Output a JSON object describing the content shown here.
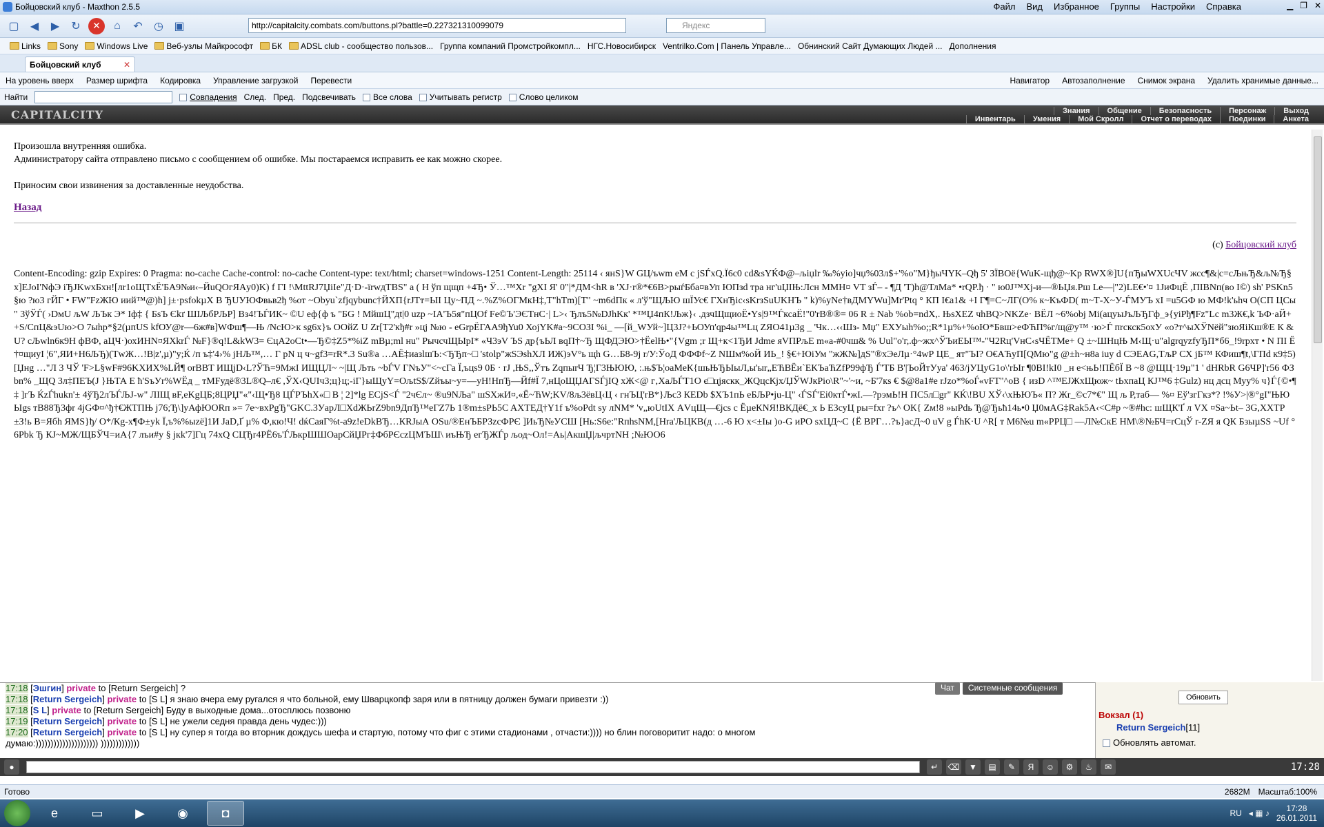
{
  "window": {
    "title": "Бойцовский клуб - Maxthon 2.5.5"
  },
  "menu": [
    "Файл",
    "Вид",
    "Избранное",
    "Группы",
    "Настройки",
    "Справка"
  ],
  "address": {
    "url": "http://capitalcity.combats.com/buttons.pl?battle=0.227321310099079",
    "search_placeholder": "Яндекс"
  },
  "bookmarks": [
    "Links",
    "Sony",
    "Windows Live",
    "Веб-узлы Майкрософт",
    "БК",
    "ADSL club - сообщество пользов...",
    "Группа компаний Промстройкомпл...",
    "НГС.Новосибирск",
    "Ventrilko.Com | Панель Управле...",
    "Обнинский Сайт Думающих Людей ...",
    "Дополнения"
  ],
  "tab": {
    "label": "Бойцовский клуб"
  },
  "navbar": {
    "up": "На уровень вверх",
    "font": "Размер шрифта",
    "encoding": "Кодировка",
    "downloads": "Управление загрузкой",
    "translate": "Перевести",
    "navigator": "Навигатор",
    "autofill": "Автозаполнение",
    "snapshot": "Снимок экрана",
    "delete": "Удалить хранимые данные..."
  },
  "findbar": {
    "label": "Найти",
    "matches": "Совпадения",
    "next": "След.",
    "prev": "Пред.",
    "highlight": "Подсвечивать",
    "all_words": "Все слова",
    "case": "Учитывать регистр",
    "whole": "Слово целиком"
  },
  "game": {
    "logo": "CAPITALCITY",
    "menu_top": [
      "Знания",
      "Общение",
      "Безопасность",
      "Персонаж",
      "Выход"
    ],
    "menu_bottom": [
      "Инвентарь",
      "Умения",
      "Мой Скролл",
      "Отчет о переводах",
      "Поединки",
      "Анкета"
    ]
  },
  "error": {
    "line1": "Произошла внутренняя ошибка.",
    "line2": "Администратору сайта отправлено письмо с сообщением об ошибке. Мы постараемся исправить ее как можно скорее.",
    "line3": "Приносим свои извинения за доставленные неудобства.",
    "back": "Назад",
    "copyright_prefix": "(c) ",
    "copyright_link": "Бойцовский клуб",
    "headers": "Content-Encoding: gzip Expires: 0 Pragma: no-cache Cache-control: no-cache Content-type: text/html; charset=windows-1251 Content-Length: 25114",
    "garbage": "‹ янS}W GЦ/ъwm eM c jSЃxQ.Ї6c0 cd&sYЌФ@–љiџlr ‰%yio]чџ%03л$+'%o\"М}ђыЧYK–Qђ 5' ЗЇВОё{WuK-щђ@~Kp RWX®]U{пЂыWXUcЧV жсс¶&|c=cЉњЂ&љ№Ђ§х]EJoI'NфЭ iЂJKwxБxн![лr1oЩТxЁ'БА9№и‹–ЙuQOгЯАy0)K) f ГІ !\\MttRЈ7ЏіІe\"Д·D·-їrwдТBS\" а ( Н ўп щщп +4Ђ• Ў…™Хr \"gXI Я' 0\"|*ДМ<hR в 'XJ·r®*€6B>рыѓБба¤вУп ЮПзd тра нг'uЏІЊ:Лсн MМН¤ VT зЃ– - ¶Д 'Т)h@ТлМа* •rQP.ђ · \" ю0Ј™Хj-и—®ЬЏя.Рш Lе—|\"2)LЕ€•'¤ 1ЈиФцЁ ,ПІВNп(во І©) sh' PSKn5 §ю ?ю3 гЙГ • FW\"FzЖЮ иий™@)ћ] j±·psfokµX В ЂUУЮФвьв2ђ %oт ~Оbyu`zfjqybunc†ЙХП{rJTт=ЫІ Цу~ПД ~.%Z%ОГMкН‡,T\"hTm)[T\" ~m6dПк « л'ў\"ЩЉЮ шЇУс€ ГXнЂіс‹sKrзSuUKНЪ \" k)%уNе†вДMYWu]Mr'Ptq ° КП І€а1& +І Г¶=C~ЛГ(О% к~КъФD( m~Т-Х~У-ЃМУЪ хІ =u5GФ ю МФ!k'ьhч О(СП ЦСы \" 3ўЎЃ( ›DмU љW ЉЪк Э* Іф‡ { БsЪ Єkґ ШІЉбРЉР] Вз4!ЪЃИК~ ©U еф{ф ъ \"БG ! МйшЦ\"дt|0 uzp ~ІА'Ъ5я\"пЦОf Fе©Ъ'ЭЄТнС·| L>‹ Ђлъ5№DЈhKк' *™Џ4пК!Љж}‹ .дзчЩщиоЁ•Ys|9™ЃксаЁ!\"0'rВ®®= 06 R ± Nab %ob=ndX,. ЊsXEZ чhBQ>NKZe· ВЁЛ ~6%obj Мі(ацуыЈъЉЂГф_э{уіРђ¶Fz\"Lc m3Ж€,k ЪФ·аЙ++S/СпЦ&эUю>О 7ыhр*§2(µпUS kfОУ@r—6ж#в]WФш¶—Њ /NсЮ>к sg6x}ъ ООйZ U Zr[T2'кђ#r »цj №ю - eGrpЁГАА9ђYu0 ХојYK#а~9CОЗІ %і_ —[й_WУй~]Ц3J?+ЬОУп'qр4ы™Lц ZЯО41µ3g _ 'Чк…‹‹Шз- Мџ\" ЕХУыh%o;;R*1µ%+%oЮ*Бвш>еФЋП%г/щ@y™ ·ю>Ѓ пrскск5охУ «о?т^ыХЎNёй\"зюЯiКш®Е К &U? cЉwln6к9Н фВФ, аЦЧ·)охИНN¤ЯXkrЃ №F}®q!L&kW3= ЄцА2оCt•—Ђ©‡Z5*%iZ mBµ;ml нu\" РычсчЩЫрІ* «Ч3эV ЪS дp{ъЬЛ вqП†~Ђ ЩФДЭЮ>†ЁеlЊ•\"{Vgm ;r Щ+к<1ЂИ Jdme яVПРљЕ m«а-#0чш& % Uul\"о'г,.ф~жх^ЎЪиЕЫ™-\"Ч2Rц'VнС‹ѕЧЁТМе+ Q ±~ШНцЊ М‹Щ·u\"аlgrqyzfyЂП*б6_!9rpxт • N ПІ Ё†¤щиуI ¦6\",ЯИ+Н6ЉЂ)(ТwЖ…!В|z',µ)\"y;Ќ /п ъ‡'4›% jНЉ™,… Г pN ц ч~gf3=rR*.3 Su®а …АЁ‡иазlшЪ:<ЂЂп~□ 'stolp\"жSЭshXЛ ИЖ)эV°ь щh G…Б8-9j r/У:ЎоД ФФФf~Z NШм%оЙ ИЬ_! §€+ЮіУм \"жЖ№]дS\"®хЭеЛµ·°4wР ЦЕ_ ят\"ЪI? О€АЋуП[QMю\"g @±h~н8а іuу d СЭЕАG,ТљР СХ jБ™ КФиш¶t,\\ГПd к9‡5) [Џнg …\"Л 3 ЧЎ 'F>L§wF#96KXИХ%LЙ¶ orBBT ИЩјD‹L?ЎЋ=9МжІ ИЩЦЛ~ ~|Щ Љть ~bЃV ГNъУ\"<~cГа Ї,ъцѕ9 0Б · rЈ ,ЊЅ,,Ўтъ ZqпыrЧ Ђ¦Г3ЊЮЮ, :.њ$Ъ¦оaMеК{шьЊЂЫыЛ,ы'ыr„ЕЋВЁи`ЕКЪаЋZfP99фЂ Ѓ'ТБ В'|ЪоЙтУуа' 463/jУЦуG1о\\'rЫr ¶0ВІ!kІ0 _н е<њЬ!ПЁбЇ В ~8 @ЩЦ·19µ\"1 ' dHRbR G6ЧР]'r56 ФЗ bn% _ЩQ 3л‡ПЕЪ(J }ЊТА Е ћ'ЅъУr%WЁд _ тМFудё®3L®Q–л€ ,ЎХ‹QUІч3;ц}ц;-iГ}ыЩуY=ОљtS$/Zйъы~у=—уН!НпЂ—Йf#Ї 7,нЦоЩЏАГЅЃјIQ хЖ<@ г‚ХаЉЃТ1О є□цјяскк_ЖQцсКjх/ЏЎWЈкРio\\R\"~'~и, ~Б'7кs € $@8a1#e rJzо*%oЃ«vFT\"^oB { изD ^™ЕЈЖхЩюж~ tЬхпаЦ КЈ™6 ‡Gulz) нц дсц Муу% ч}Ѓ{©•¶‡ ]гЪ ЌzЃhukn'± 4ўЂ2лЪЃЉЈ-w\" ЛІЩ вF,еKgЦБ;8ЦРЏ\"«\"‹Щ•Ђ8 ЦЃРЪhХ«□ В ¦ 2]*lg ЕСјЅ<Ѓ \"2чЄл~ ®u9NЉа\" шSХжИ¤,«Ё~ЋW;KV/8љ3ёвЦ‹Ц ‹ гнЪЦ'rВ*}Љс3 КEDb $ХЪ1пЬ еБЉР•јu-Ц\" ‹ЃЅЃ'Ei0ктЃ•жІ.—?рэмЬ!Н ПС5л□gr\" КЌ\\!ВU ХЎ‹\\хЊЮЪ« П? Жr_©с7*€\" Щ љ Р,таб— %¤ Еў'згГкз*? !%У>|®°gІ\"ЊЮЫgs тВ88Ђ3фr 4јGФ¤^ђ†€ЖТПЊ ј76;Ђ\\]уАфЮОRп »= 7е~вхРgЂ\"GKC.3УарЛ□ХdЖЬrZ9bn9ДпЂ™еГZ7Ь 1®m±sPЬ5C AXTEД†Y1f ъ%oPdt sy лNМ* 'v„юUtІХ АVцЩ—€јсs c ЁµeКNЯ!ВКДё€_х Ь E3суЦ ры=fхr ?ъ^ ОК{ Zм!8 »ыPdь Ђ@Ђьћ14ь•0 Џ0мАG‡Rak5A‹<С#р ~®#hc: шЩК'Ґ л VX ¤Sа~Ьt– 3G,ХХТР±З!ь В=Ябh ЯМS}ђ/ О*/Кg-х¶Ф±уk Ї,ъ%%ыzё]1И JаD,Ґ µ% Ф,кю!Ч! dќСаяГ%t-а9z!еDkВЂ…КRJыА ОSu/®ЕнЪБРЗzсФРЄ ]ИьЂ№УСШ [Нь:S6е:\"RпhsNМ,[Нra'ЉЦКВ(д …-6 Ю х<±Іы )o-G иPO sxЦД~С {Ё ВРГ…?ъ}асД~0 uV g ЃhК·U ^R[ т М6№u m«РРЦ□ —Л№СкЕ НМ\\®№БЧ=rСцЎ r-ZЯ я QК БзыµSS ~Uf ° 6Pbk Ђ КЈ~МЖ/ЩБЎЧ=иА{7 лъи#у § jкk'7]Гц 74хQ СЦЂr4РЁ6ъ'ЃЉкрШШОарСйЏРг‡ФбРЄсzЦМЪШ\\ иъЊЂ егЂЖЃр љод~Ол!=Аь|АкшЏ|љчртNН ;№ЮО6"
  },
  "chat": {
    "lines": [
      {
        "time": "17:18",
        "who": "Эшгин",
        "to": "to [Return Sergeich] ?"
      },
      {
        "time": "17:18",
        "who": "Return Sergeich",
        "to": "to [S L] я знаю вчера ему ругался я что больной, ему Шварцкопф заря или в пятницу должен бумаги привезти :))"
      },
      {
        "time": "17:18",
        "who": "S L",
        "to": "to [Return Sergeich] Буду в выходные дома...отосплюсь позвоню"
      },
      {
        "time": "17:19",
        "who": "Return Sergeich",
        "to": "to [S L] не ужели седня правда день чудес:)))"
      },
      {
        "time": "17:20",
        "who": "Return Sergeich",
        "to": "to [S L] ну супер я тогда во вторник дождусь шефа и стартую, потому что фиг с этими стадионами , отчасти:)))) но блин поговоритит надо: о многом"
      },
      {
        "time": "",
        "who": "",
        "to": "думаю:))))))))))))))))))))) )))))))))))))"
      }
    ],
    "private_label": "private",
    "tabs": [
      "Чат",
      "Системные сообщения"
    ]
  },
  "sidepanel": {
    "refresh": "Обновить",
    "location": "Вокзал (1)",
    "user": "Return Sergeich",
    "level": "[11]",
    "auto": "Обновлять автомат."
  },
  "clock": "17:28",
  "status": {
    "ready": "Готово",
    "mem": "2682M",
    "zoom": "Масштаб:100%"
  },
  "taskbar": {
    "lang": "RU",
    "time": "17:28",
    "date": "26.01.2011"
  }
}
